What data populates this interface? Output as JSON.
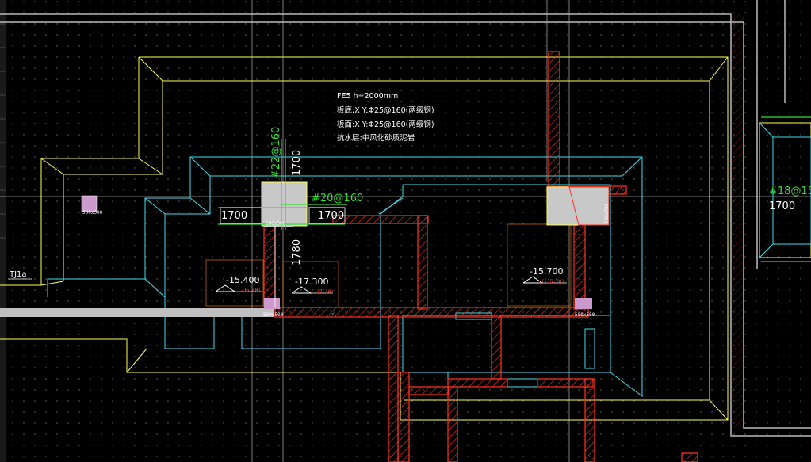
{
  "colors": {
    "background": "#000000",
    "outline_yellow": "#ffff55",
    "outline_cyan": "#44ddee",
    "wall_red": "#ff3322",
    "rebar_green": "#33dd33",
    "text_white": "#ffffff",
    "column_fill": "#c8c8c8",
    "pile_magenta": "#cc99cc",
    "beam_gray": "#bfbfbf"
  },
  "note": {
    "line1": "FE5  h=2000mm",
    "line2": "板底:X  Y:Φ25@160(两级钢)",
    "line3": "板面:X  Y:Φ25@160(两级钢)",
    "line4": "抗水层:中风化砂质泥岩"
  },
  "rebar": {
    "vertical_label": "#22@160",
    "horizontal_label": "#20@160",
    "right_label": "#18@150"
  },
  "dims": {
    "d1": "1700",
    "d2": "1700",
    "d3": "1700",
    "d4": "1780",
    "d5": "1700"
  },
  "elevations": {
    "e1": "-15.400",
    "e1_sub": "(-15.40)",
    "e2": "-17.300",
    "e2_sub": "(-17.30)",
    "e3": "-15.700",
    "e3_sub": "(-15.70)"
  },
  "labels": {
    "left_tag": "TJ1a",
    "column_tag_1": "500x500",
    "column_tag_2": "500x500",
    "column_tag_3": "500x500",
    "column_tag_4": "700x700",
    "column_tag_5": "500x500"
  }
}
